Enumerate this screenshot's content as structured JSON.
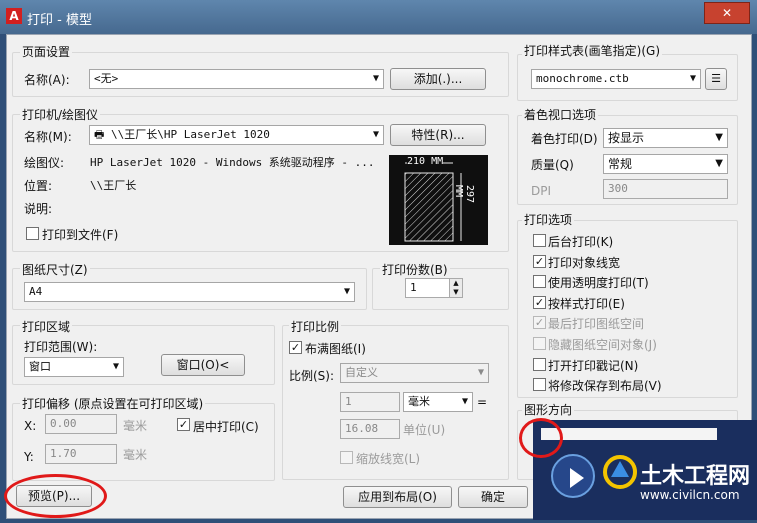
{
  "window": {
    "title": "打印 - 模型",
    "logo": "A",
    "close": "✕"
  },
  "page_setup": {
    "group_label": "页面设置",
    "name_label": "名称(A):",
    "name_value": "<无>",
    "add_button": "添加(.)..."
  },
  "printer": {
    "group_label": "打印机/绘图仪",
    "name_label": "名称(M):",
    "name_value": "\\\\王厂长\\HP LaserJet 1020",
    "properties_button": "特性(R)...",
    "plotter_label": "绘图仪:",
    "plotter_value": "HP LaserJet 1020 - Windows 系统驱动程序 -  ...",
    "location_label": "位置:",
    "location_value": "\\\\王厂长",
    "description_label": "说明:",
    "print_to_file": "打印到文件(F)",
    "preview_width": "210 MM",
    "preview_height": "297 MM"
  },
  "paper_size": {
    "group_label": "图纸尺寸(Z)",
    "value": "A4"
  },
  "copies": {
    "group_label": "打印份数(B)",
    "value": "1"
  },
  "plot_area": {
    "group_label": "打印区域",
    "what_label": "打印范围(W):",
    "what_value": "窗口",
    "window_button": "窗口(O)<"
  },
  "plot_offset": {
    "group_label": "打印偏移 (原点设置在可打印区域)",
    "x_label": "X:",
    "x_value": "0.00",
    "x_unit": "毫米",
    "y_label": "Y:",
    "y_value": "1.70",
    "y_unit": "毫米",
    "center": "居中打印(C)"
  },
  "plot_scale": {
    "group_label": "打印比例",
    "fit_paper": "布满图纸(I)",
    "scale_label": "比例(S):",
    "scale_value": "自定义",
    "value1": "1",
    "unit_value": "毫米",
    "equals": "=",
    "value2": "16.08",
    "unit_label": "单位(U)",
    "scale_lineweights": "缩放线宽(L)"
  },
  "style_table": {
    "group_label": "打印样式表(画笔指定)(G)",
    "value": "monochrome.ctb"
  },
  "shaded": {
    "group_label": "着色视口选项",
    "shade_label": "着色打印(D)",
    "shade_value": "按显示",
    "quality_label": "质量(Q)",
    "quality_value": "常规",
    "dpi_label": "DPI",
    "dpi_value": "300"
  },
  "options": {
    "group_label": "打印选项",
    "items": [
      {
        "label": "后台打印(K)",
        "checked": false,
        "disabled": false
      },
      {
        "label": "打印对象线宽",
        "checked": true,
        "disabled": false
      },
      {
        "label": "使用透明度打印(T)",
        "checked": false,
        "disabled": false
      },
      {
        "label": "按样式打印(E)",
        "checked": true,
        "disabled": false
      },
      {
        "label": "最后打印图纸空间",
        "checked": true,
        "disabled": true
      },
      {
        "label": "隐藏图纸空间对象(J)",
        "checked": false,
        "disabled": true
      },
      {
        "label": "打开打印戳记(N)",
        "checked": false,
        "disabled": false
      },
      {
        "label": "将修改保存到布局(V)",
        "checked": false,
        "disabled": false
      }
    ]
  },
  "orientation": {
    "group_label": "图形方向"
  },
  "footer": {
    "preview_button": "预览(P)...",
    "apply_button": "应用到布局(O)",
    "ok_button": "确定"
  },
  "watermark": {
    "title": "土木工程网",
    "url": "www.civilcn.com"
  },
  "colors": {
    "title_bar": "#4f759c",
    "dialog_bg": "#f0f0f0",
    "highlight_ring": "#e01919",
    "overlay": "#1a2e5e"
  }
}
